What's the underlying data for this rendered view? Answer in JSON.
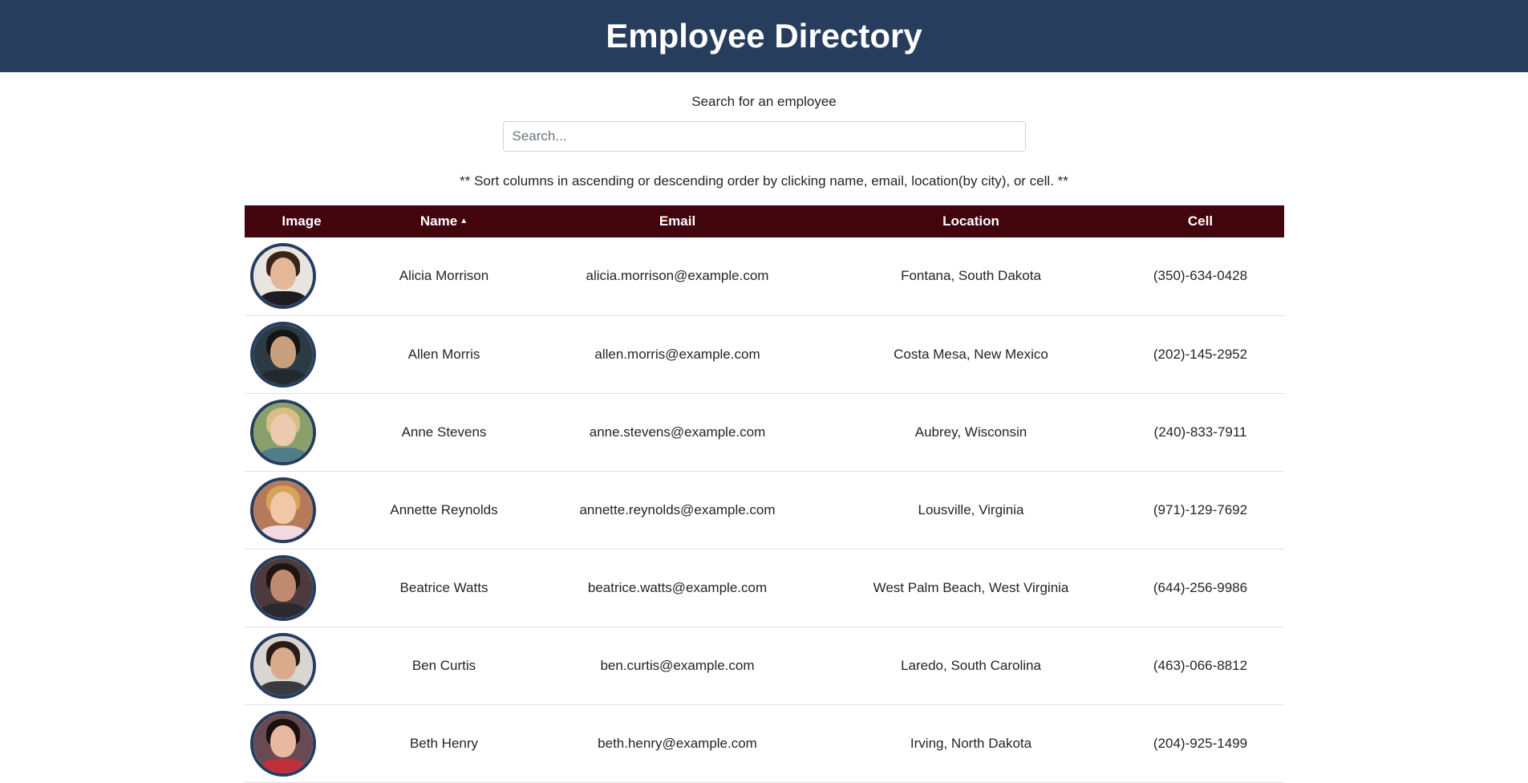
{
  "header": {
    "title": "Employee Directory"
  },
  "search": {
    "label": "Search for an employee",
    "placeholder": "Search...",
    "value": ""
  },
  "sort_note": "** Sort columns in ascending or descending order by clicking name, email, location(by city), or cell. **",
  "table": {
    "columns": [
      "Image",
      "Name",
      "Email",
      "Location",
      "Cell"
    ],
    "sorted_column": "Name",
    "sort_direction": "ascending",
    "rows": [
      {
        "name": "Alicia Morrison",
        "email": "alicia.morrison@example.com",
        "location": "Fontana, South Dakota",
        "cell": "(350)-634-0428",
        "avatar": {
          "bg": "#e8e4e0",
          "hair": "#3a2418",
          "skin": "#e2b79a",
          "clothes": "#1c1c22"
        }
      },
      {
        "name": "Allen Morris",
        "email": "allen.morris@example.com",
        "location": "Costa Mesa, New Mexico",
        "cell": "(202)-145-2952",
        "avatar": {
          "bg": "#2c3a44",
          "hair": "#151515",
          "skin": "#c9a07e",
          "clothes": "#222a30"
        }
      },
      {
        "name": "Anne Stevens",
        "email": "anne.stevens@example.com",
        "location": "Aubrey, Wisconsin",
        "cell": "(240)-833-7911",
        "avatar": {
          "bg": "#8aa06a",
          "hair": "#d9bd86",
          "skin": "#edc9ad",
          "clothes": "#4f7d8a"
        }
      },
      {
        "name": "Annette Reynolds",
        "email": "annette.reynolds@example.com",
        "location": "Lousville, Virginia",
        "cell": "(971)-129-7692",
        "avatar": {
          "bg": "#b57a5a",
          "hair": "#d8a25a",
          "skin": "#f0c8a8",
          "clothes": "#f1d9e0"
        }
      },
      {
        "name": "Beatrice Watts",
        "email": "beatrice.watts@example.com",
        "location": "West Palm Beach, West Virginia",
        "cell": "(644)-256-9986",
        "avatar": {
          "bg": "#4c3a3c",
          "hair": "#1e1412",
          "skin": "#c08a72",
          "clothes": "#2a2a2e"
        }
      },
      {
        "name": "Ben Curtis",
        "email": "ben.curtis@example.com",
        "location": "Laredo, South Carolina",
        "cell": "(463)-066-8812",
        "avatar": {
          "bg": "#d8d6d2",
          "hair": "#2a1c14",
          "skin": "#d9ab8c",
          "clothes": "#3a3a40"
        }
      },
      {
        "name": "Beth Henry",
        "email": "beth.henry@example.com",
        "location": "Irving, North Dakota",
        "cell": "(204)-925-1499",
        "avatar": {
          "bg": "#6a4a52",
          "hair": "#1a1010",
          "skin": "#e8b8a0",
          "clothes": "#c0303a"
        }
      }
    ]
  }
}
